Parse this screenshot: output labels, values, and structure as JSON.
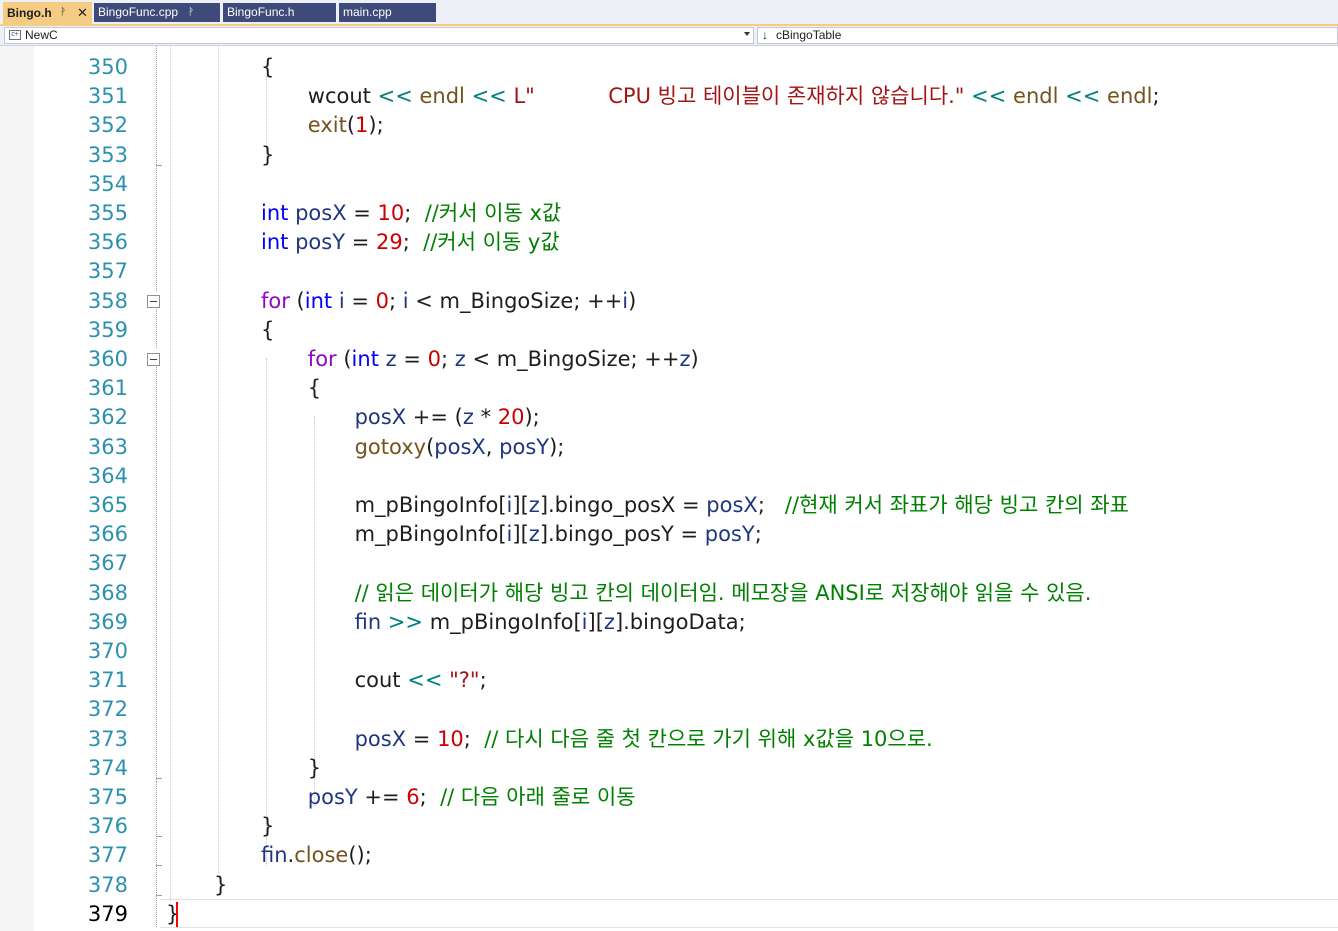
{
  "tabs": [
    {
      "label": "Bingo.h",
      "active": true,
      "pinned": true
    },
    {
      "label": "BingoFunc.cpp",
      "active": false,
      "pinned": true
    },
    {
      "label": "BingoFunc.h",
      "active": false,
      "pinned": false
    },
    {
      "label": "main.cpp",
      "active": false,
      "pinned": false
    }
  ],
  "nav": {
    "project": "NewC",
    "scope": "cBingoTable"
  },
  "editor": {
    "current_line": 379,
    "lines": [
      {
        "n": "350",
        "t": [
          [
            "",
            "{"
          ]
        ]
      },
      {
        "n": "351",
        "t": [
          [
            "",
            "wcout "
          ],
          [
            "op",
            "<<"
          ],
          [
            "",
            " "
          ],
          [
            "fn",
            "endl"
          ],
          [
            "",
            " "
          ],
          [
            "op",
            "<<"
          ],
          [
            "",
            " "
          ],
          [
            "str",
            "L\"           CPU 빙고 테이블이 존재하지 않습니다.\""
          ],
          [
            "",
            " "
          ],
          [
            "op",
            "<<"
          ],
          [
            "",
            " "
          ],
          [
            "fn",
            "endl"
          ],
          [
            "",
            " "
          ],
          [
            "op",
            "<<"
          ],
          [
            "",
            " "
          ],
          [
            "fn",
            "endl"
          ],
          [
            "",
            ";"
          ]
        ]
      },
      {
        "n": "352",
        "t": [
          [
            "fn",
            "exit"
          ],
          [
            "",
            "("
          ],
          [
            "num",
            "1"
          ],
          [
            "",
            ");"
          ]
        ]
      },
      {
        "n": "353",
        "t": [
          [
            "",
            "}"
          ]
        ]
      },
      {
        "n": "354",
        "t": []
      },
      {
        "n": "355",
        "t": [
          [
            "k",
            "int"
          ],
          [
            "",
            " "
          ],
          [
            "var",
            "posX"
          ],
          [
            "",
            " = "
          ],
          [
            "num",
            "10"
          ],
          [
            "",
            ";  "
          ],
          [
            "cm",
            "//커서 이동 x값"
          ]
        ]
      },
      {
        "n": "356",
        "t": [
          [
            "k",
            "int"
          ],
          [
            "",
            " "
          ],
          [
            "var",
            "posY"
          ],
          [
            "",
            " = "
          ],
          [
            "num",
            "29"
          ],
          [
            "",
            ";  "
          ],
          [
            "cm",
            "//커서 이동 y값"
          ]
        ]
      },
      {
        "n": "357",
        "t": []
      },
      {
        "n": "358",
        "t": [
          [
            "kw2",
            "for"
          ],
          [
            "",
            " ("
          ],
          [
            "k",
            "int"
          ],
          [
            "",
            " "
          ],
          [
            "var",
            "i"
          ],
          [
            "",
            " = "
          ],
          [
            "num",
            "0"
          ],
          [
            "",
            "; "
          ],
          [
            "var",
            "i"
          ],
          [
            "",
            " < m_BingoSize; ++"
          ],
          [
            "var",
            "i"
          ],
          [
            "",
            ")"
          ]
        ]
      },
      {
        "n": "359",
        "t": [
          [
            "",
            "{"
          ]
        ]
      },
      {
        "n": "360",
        "t": [
          [
            "kw2",
            "for"
          ],
          [
            "",
            " ("
          ],
          [
            "k",
            "int"
          ],
          [
            "",
            " "
          ],
          [
            "var",
            "z"
          ],
          [
            "",
            " = "
          ],
          [
            "num",
            "0"
          ],
          [
            "",
            "; "
          ],
          [
            "var",
            "z"
          ],
          [
            "",
            " < m_BingoSize; ++"
          ],
          [
            "var",
            "z"
          ],
          [
            "",
            ")"
          ]
        ]
      },
      {
        "n": "361",
        "t": [
          [
            "",
            "{"
          ]
        ]
      },
      {
        "n": "362",
        "t": [
          [
            "var",
            "posX"
          ],
          [
            "",
            " += ("
          ],
          [
            "var",
            "z"
          ],
          [
            "",
            " * "
          ],
          [
            "num",
            "20"
          ],
          [
            "",
            ");"
          ]
        ]
      },
      {
        "n": "363",
        "t": [
          [
            "fn",
            "gotoxy"
          ],
          [
            "",
            "("
          ],
          [
            "var",
            "posX"
          ],
          [
            "",
            ", "
          ],
          [
            "var",
            "posY"
          ],
          [
            "",
            ");"
          ]
        ]
      },
      {
        "n": "364",
        "t": []
      },
      {
        "n": "365",
        "t": [
          [
            "",
            "m_pBingoInfo["
          ],
          [
            "var",
            "i"
          ],
          [
            "",
            "]["
          ],
          [
            "var",
            "z"
          ],
          [
            "",
            "].bingo_posX = "
          ],
          [
            "var",
            "posX"
          ],
          [
            "",
            ";   "
          ],
          [
            "cm",
            "//현재 커서 좌표가 해당 빙고 칸의 좌표"
          ]
        ]
      },
      {
        "n": "366",
        "t": [
          [
            "",
            "m_pBingoInfo["
          ],
          [
            "var",
            "i"
          ],
          [
            "",
            "]["
          ],
          [
            "var",
            "z"
          ],
          [
            "",
            "].bingo_posY = "
          ],
          [
            "var",
            "posY"
          ],
          [
            "",
            ";"
          ]
        ]
      },
      {
        "n": "367",
        "t": []
      },
      {
        "n": "368",
        "t": [
          [
            "cm",
            "// 읽은 데이터가 해당 빙고 칸의 데이터임. 메모장을 ANSI로 저장해야 읽을 수 있음."
          ]
        ]
      },
      {
        "n": "369",
        "t": [
          [
            "var",
            "fin"
          ],
          [
            "",
            " "
          ],
          [
            "op",
            ">>"
          ],
          [
            "",
            " m_pBingoInfo["
          ],
          [
            "var",
            "i"
          ],
          [
            "",
            "]["
          ],
          [
            "var",
            "z"
          ],
          [
            "",
            "].bingoData;"
          ]
        ]
      },
      {
        "n": "370",
        "t": []
      },
      {
        "n": "371",
        "t": [
          [
            "",
            "cout "
          ],
          [
            "op",
            "<<"
          ],
          [
            "",
            " "
          ],
          [
            "str",
            "\"?\""
          ],
          [
            "",
            ";"
          ]
        ]
      },
      {
        "n": "372",
        "t": []
      },
      {
        "n": "373",
        "t": [
          [
            "var",
            "posX"
          ],
          [
            "",
            " = "
          ],
          [
            "num",
            "10"
          ],
          [
            "",
            ";  "
          ],
          [
            "cm",
            "// 다시 다음 줄 첫 칸으로 가기 위해 x값을 10으로."
          ]
        ]
      },
      {
        "n": "374",
        "t": [
          [
            "",
            "}"
          ]
        ]
      },
      {
        "n": "375",
        "t": [
          [
            "var",
            "posY"
          ],
          [
            "",
            " += "
          ],
          [
            "num",
            "6"
          ],
          [
            "",
            ";  "
          ],
          [
            "cm",
            "// 다음 아래 줄로 이동"
          ]
        ]
      },
      {
        "n": "376",
        "t": [
          [
            "",
            "}"
          ]
        ]
      },
      {
        "n": "377",
        "t": [
          [
            "var",
            "fin"
          ],
          [
            "",
            "."
          ],
          [
            "fn",
            "close"
          ],
          [
            "",
            "();"
          ]
        ]
      },
      {
        "n": "378",
        "t": [
          [
            "",
            "}"
          ]
        ]
      },
      {
        "n": "379",
        "t": [
          [
            "",
            "}"
          ]
        ]
      }
    ]
  }
}
